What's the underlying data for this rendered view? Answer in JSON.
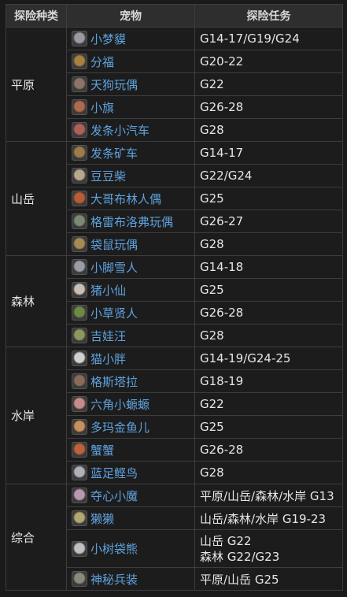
{
  "headers": {
    "category": "探险种类",
    "pet": "宠物",
    "task": "探险任务"
  },
  "groups": [
    {
      "category": "平原",
      "rows": [
        {
          "icon": "sheep-icon",
          "color": "#9a9aa2",
          "name": "小梦貘",
          "task": [
            "G14-17/G19/G24"
          ]
        },
        {
          "icon": "dog-icon",
          "color": "#a8813e",
          "name": "分福",
          "task": [
            "G20-22"
          ]
        },
        {
          "icon": "doll-icon",
          "color": "#8c7468",
          "name": "天狗玩偶",
          "task": [
            "G22"
          ]
        },
        {
          "icon": "flag-icon",
          "color": "#b06a4a",
          "name": "小旗",
          "task": [
            "G26-28"
          ]
        },
        {
          "icon": "toy-car-icon",
          "color": "#b0605a",
          "name": "发条小汽车",
          "task": [
            "G28"
          ]
        }
      ]
    },
    {
      "category": "山岳",
      "rows": [
        {
          "icon": "mine-cart-icon",
          "color": "#9e7c4a",
          "name": "发条矿车",
          "task": [
            "G14-17"
          ]
        },
        {
          "icon": "shiba-icon",
          "color": "#b9a78e",
          "name": "豆豆柴",
          "task": [
            "G22/G24"
          ]
        },
        {
          "icon": "goblin-doll-icon",
          "color": "#b85c36",
          "name": "大哥布林人偶",
          "task": [
            "G25"
          ]
        },
        {
          "icon": "gremlin-doll-icon",
          "color": "#7b8a72",
          "name": "格雷布洛弗玩偶",
          "task": [
            "G26-27"
          ]
        },
        {
          "icon": "mole-doll-icon",
          "color": "#a88a52",
          "name": "袋鼠玩偶",
          "task": [
            "G28"
          ]
        }
      ]
    },
    {
      "category": "森林",
      "rows": [
        {
          "icon": "yeti-icon",
          "color": "#9a9ca6",
          "name": "小脚雪人",
          "task": [
            "G14-18"
          ]
        },
        {
          "icon": "pig-icon",
          "color": "#c8c0b8",
          "name": "猪小仙",
          "task": [
            "G25"
          ]
        },
        {
          "icon": "leaf-sage-icon",
          "color": "#6c8a44",
          "name": "小草贤人",
          "task": [
            "G26-28"
          ]
        },
        {
          "icon": "mandragora-icon",
          "color": "#8a9a5a",
          "name": "吉娃汪",
          "task": [
            "G28"
          ]
        }
      ]
    },
    {
      "category": "水岸",
      "rows": [
        {
          "icon": "cat-icon",
          "color": "#d0d0d0",
          "name": "猫小胖",
          "task": [
            "G14-19/G24-25"
          ]
        },
        {
          "icon": "gastalla-icon",
          "color": "#8a6a5a",
          "name": "格斯塔拉",
          "task": [
            "G18-19"
          ]
        },
        {
          "icon": "axolotl-icon",
          "color": "#c88a8a",
          "name": "六角小螈螈",
          "task": [
            "G22"
          ]
        },
        {
          "icon": "goldfish-icon",
          "color": "#c8905a",
          "name": "多玛金鱼儿",
          "task": [
            "G25"
          ]
        },
        {
          "icon": "crab-icon",
          "color": "#c0603a",
          "name": "蟹蟹",
          "task": [
            "G26-28"
          ]
        },
        {
          "icon": "bird-icon",
          "color": "#b0b0b8",
          "name": "蓝足鲣鸟",
          "task": [
            "G28"
          ]
        }
      ]
    },
    {
      "category": "综合",
      "rows": [
        {
          "icon": "imp-icon",
          "color": "#b89ab0",
          "name": "夺心小魔",
          "task": [
            "平原/山岳/森林/水岸 G13"
          ]
        },
        {
          "icon": "chocobo-icon",
          "color": "#b0a870",
          "name": "獭獭",
          "task": [
            "山岳/森林/水岸 G19-23"
          ]
        },
        {
          "icon": "koala-icon",
          "color": "#c0c0c0",
          "name": "小树袋熊",
          "task": [
            "山岳 G22",
            "森林 G22/G23"
          ]
        },
        {
          "icon": "armor-icon",
          "color": "#8a8a7a",
          "name": "神秘兵装",
          "task": [
            "平原/山岳 G25"
          ]
        }
      ]
    }
  ]
}
